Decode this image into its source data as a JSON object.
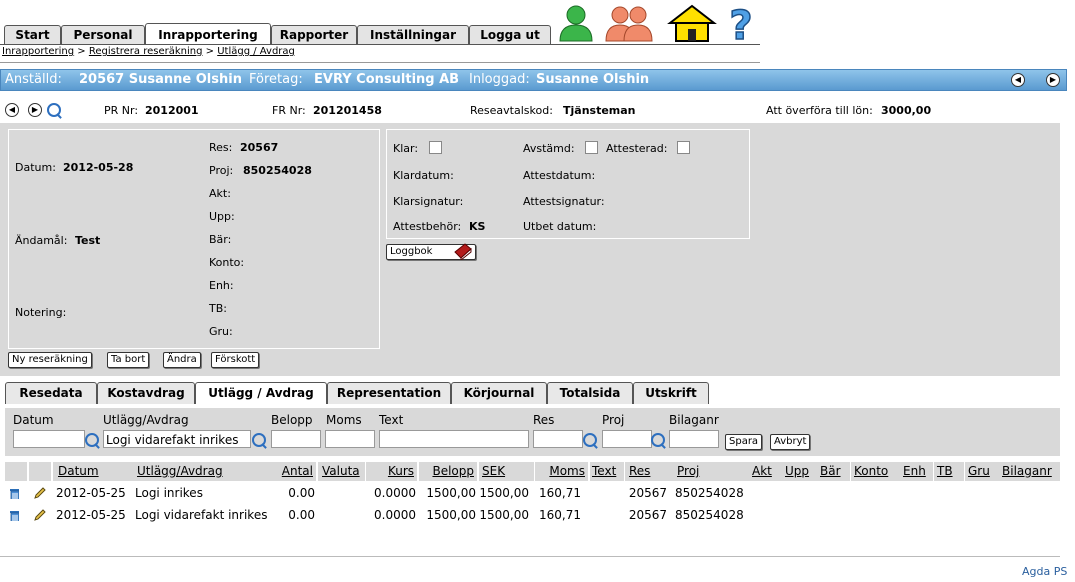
{
  "nav": {
    "tabs": [
      "Start",
      "Personal",
      "Inrapportering",
      "Rapporter",
      "Inställningar",
      "Logga ut"
    ],
    "active_tab": "Inrapportering"
  },
  "breadcrumb": [
    "Inrapportering",
    "Registrera reseräkning",
    "Utlägg / Avdrag"
  ],
  "header": {
    "employee_label": "Anställd:",
    "employee_value": "20567 Susanne Olshin",
    "company_label": "Företag:",
    "company_value": "EVRY Consulting AB",
    "logged_label": "Inloggad:",
    "logged_value": "Susanne Olshin"
  },
  "info": {
    "pr_label": "PR Nr:",
    "pr_value": "2012001",
    "fr_label": "FR Nr:",
    "fr_value": "201201458",
    "agreement_label": "Reseavtalskod:",
    "agreement_value": "Tjänsteman",
    "transfer_label": "Att överföra till lön:",
    "transfer_value": "3000,00"
  },
  "details": {
    "date_label": "Datum:",
    "date_value": "2012-05-28",
    "purpose_label": "Ändamål:",
    "purpose_value": "Test",
    "note_label": "Notering:",
    "res_label": "Res:",
    "res_value": "20567",
    "proj_label": "Proj:",
    "proj_value": "850254028",
    "akt_label": "Akt:",
    "upp_label": "Upp:",
    "bar_label": "Bär:",
    "konto_label": "Konto:",
    "enh_label": "Enh:",
    "tb_label": "TB:",
    "gru_label": "Gru:"
  },
  "status": {
    "klar_label": "Klar:",
    "avstamd_label": "Avstämd:",
    "attesterad_label": "Attesterad:",
    "klardatum_label": "Klardatum:",
    "attestdatum_label": "Attestdatum:",
    "klarsignatur_label": "Klarsignatur:",
    "attestsignatur_label": "Attestsignatur:",
    "attestbehor_label": "Attestbehör:",
    "attestbehor_value": "KS",
    "utbet_label": "Utbet datum:",
    "loggbok_label": "Loggbok"
  },
  "actions": {
    "new_label": "Ny reseräkning",
    "delete_label": "Ta bort",
    "edit_label": "Ändra",
    "advance_label": "Förskott"
  },
  "subtabs": [
    "Resedata",
    "Kostavdrag",
    "Utlägg / Avdrag",
    "Representation",
    "Körjournal",
    "Totalsida",
    "Utskrift"
  ],
  "form": {
    "datum_label": "Datum",
    "utlagg_label": "Utlägg/Avdrag",
    "belopp_label": "Belopp",
    "moms_label": "Moms",
    "text_label": "Text",
    "res_label": "Res",
    "proj_label": "Proj",
    "bilaganr_label": "Bilaganr",
    "utlagg_value": "Logi vidarefakt inrikes",
    "save_label": "Spara",
    "cancel_label": "Avbryt"
  },
  "table": {
    "columns": [
      "Datum",
      "Utlägg/Avdrag",
      "Antal",
      "Valuta",
      "Kurs",
      "Belopp",
      "SEK",
      "Moms",
      "Text",
      "Res",
      "Proj",
      "Akt",
      "Upp",
      "Bär",
      "Konto",
      "Enh",
      "TB",
      "Gru",
      "Bilaganr"
    ],
    "rows": [
      {
        "datum": "2012-05-25",
        "utlagg": "Logi inrikes",
        "antal": "0.00",
        "kurs": "0.0000",
        "belopp": "1500,00",
        "sek": "1500,00",
        "moms": "160,71",
        "res": "20567",
        "proj": "850254028"
      },
      {
        "datum": "2012-05-25",
        "utlagg": "Logi vidarefakt inrikes",
        "antal": "0.00",
        "kurs": "0.0000",
        "belopp": "1500,00",
        "sek": "1500,00",
        "moms": "160,71",
        "res": "20567",
        "proj": "850254028"
      }
    ]
  },
  "footer": {
    "brand": "Agda PS"
  }
}
